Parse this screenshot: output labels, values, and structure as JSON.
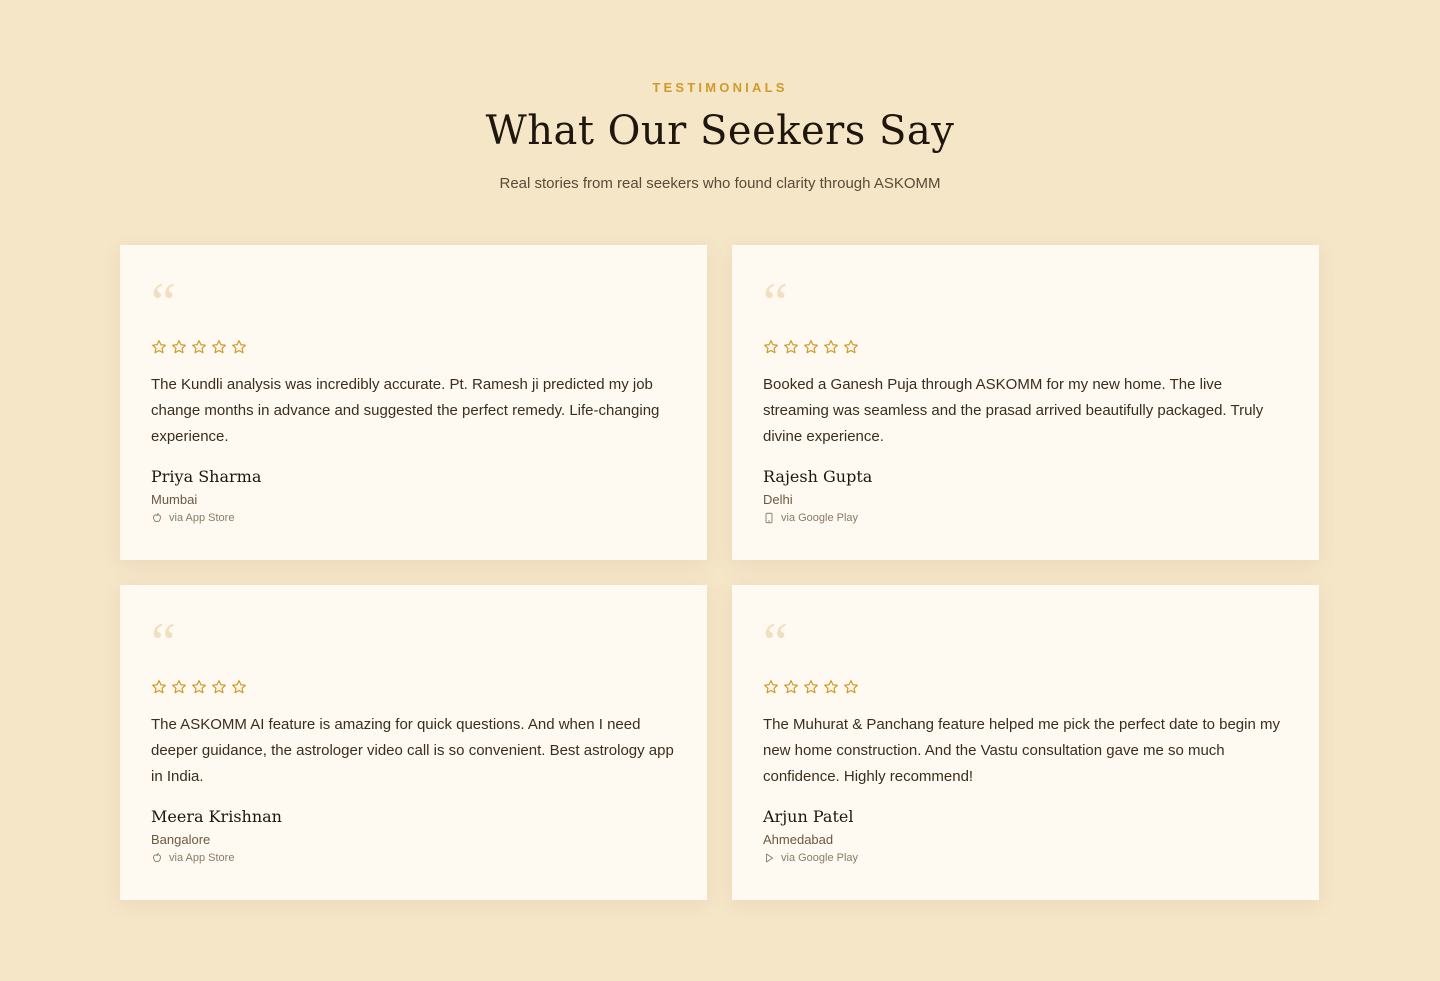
{
  "header": {
    "eyebrow": "TESTIMONIALS",
    "title": "What Our Seekers Say",
    "subtitle": "Real stories from real seekers who found clarity through ASKOMM"
  },
  "colors": {
    "background": "#f5e6c8",
    "card": "#fffaf1",
    "accent": "#d29a2a",
    "quote_mark": "#f0dfc0"
  },
  "quote_glyph": "“",
  "testimonials": [
    {
      "rating": 5,
      "text": "The Kundli analysis was incredibly accurate. Pt. Ramesh ji predicted my job change months in advance and suggested the perfect remedy. Life-changing experience.",
      "name": "Priya Sharma",
      "city": "Mumbai",
      "source": "via App Store",
      "source_icon": "apple-icon"
    },
    {
      "rating": 5,
      "text": "Booked a Ganesh Puja through ASKOMM for my new home. The live streaming was seamless and the prasad arrived beautifully packaged. Truly divine experience.",
      "name": "Rajesh Gupta",
      "city": "Delhi",
      "source": "via Google Play",
      "source_icon": "phone-icon"
    },
    {
      "rating": 5,
      "text": "The ASKOMM AI feature is amazing for quick questions. And when I need deeper guidance, the astrologer video call is so convenient. Best astrology app in India.",
      "name": "Meera Krishnan",
      "city": "Bangalore",
      "source": "via App Store",
      "source_icon": "apple-icon"
    },
    {
      "rating": 5,
      "text": "The Muhurat & Panchang feature helped me pick the perfect date to begin my new home construction. And the Vastu consultation gave me so much confidence. Highly recommend!",
      "name": "Arjun Patel",
      "city": "Ahmedabad",
      "source": "via Google Play",
      "source_icon": "play-icon"
    }
  ]
}
